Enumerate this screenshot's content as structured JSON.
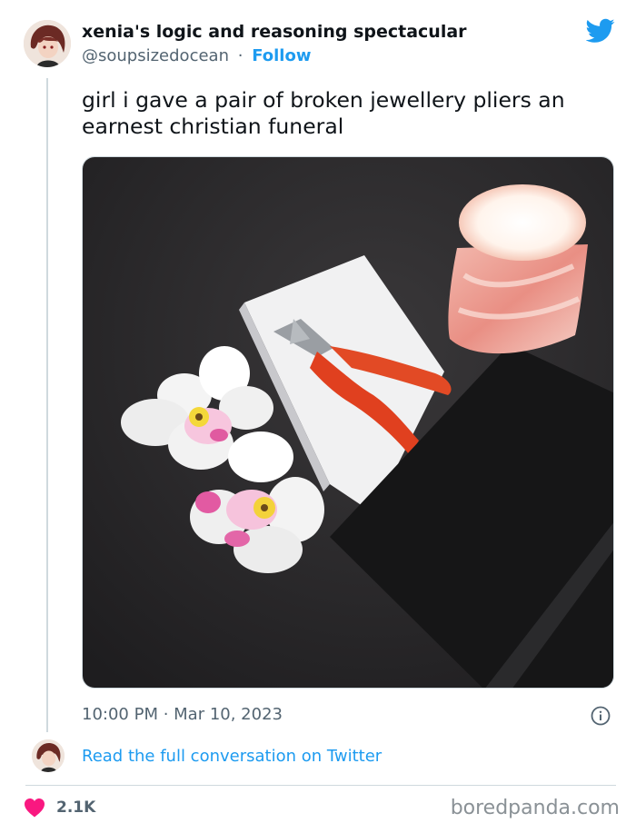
{
  "tweet": {
    "author_name": "xenia's logic and reasoning spectacular",
    "handle": "@soupsizedocean",
    "separator": "·",
    "follow_label": "Follow",
    "text": "girl i gave a pair of broken jewellery pliers an earnest christian funeral",
    "timestamp": "10:00 PM · Mar 10, 2023",
    "read_more_label": "Read the full conversation on Twitter",
    "like_count": "2.1K"
  },
  "footer": {
    "brand": "boredpanda.com"
  },
  "icons": {
    "logo": "twitter-bird-icon",
    "info": "info-icon",
    "like": "heart-icon"
  },
  "colors": {
    "accent": "#1d9bf0",
    "heart": "#f91880",
    "muted": "#536471"
  }
}
